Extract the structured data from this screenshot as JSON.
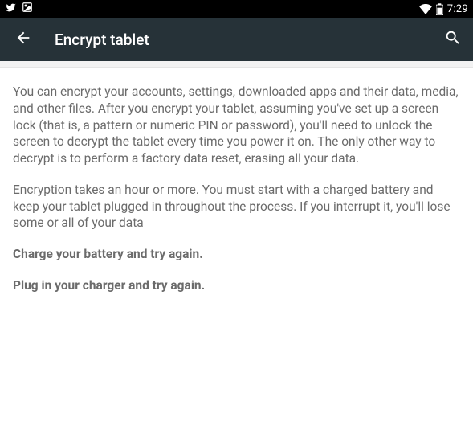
{
  "status_bar": {
    "clock": "7:29"
  },
  "app_bar": {
    "title": "Encrypt tablet"
  },
  "content": {
    "paragraph1": "You can encrypt your accounts, settings, downloaded apps and their data, media, and other files. After you encrypt your tablet, assuming you've set up a screen lock (that is, a pattern or numeric PIN or password), you'll need to unlock the screen to decrypt the tablet every time you power it on. The only other way to decrypt is to perform a factory data reset, erasing all your data.",
    "paragraph2": "Encryption takes an hour or more. You must start with a charged battery and keep your tablet plugged in throughout the process. If you interrupt it, you'll lose some or all of your data",
    "warning1": "Charge your battery and try again.",
    "warning2": "Plug in your charger and try again."
  }
}
